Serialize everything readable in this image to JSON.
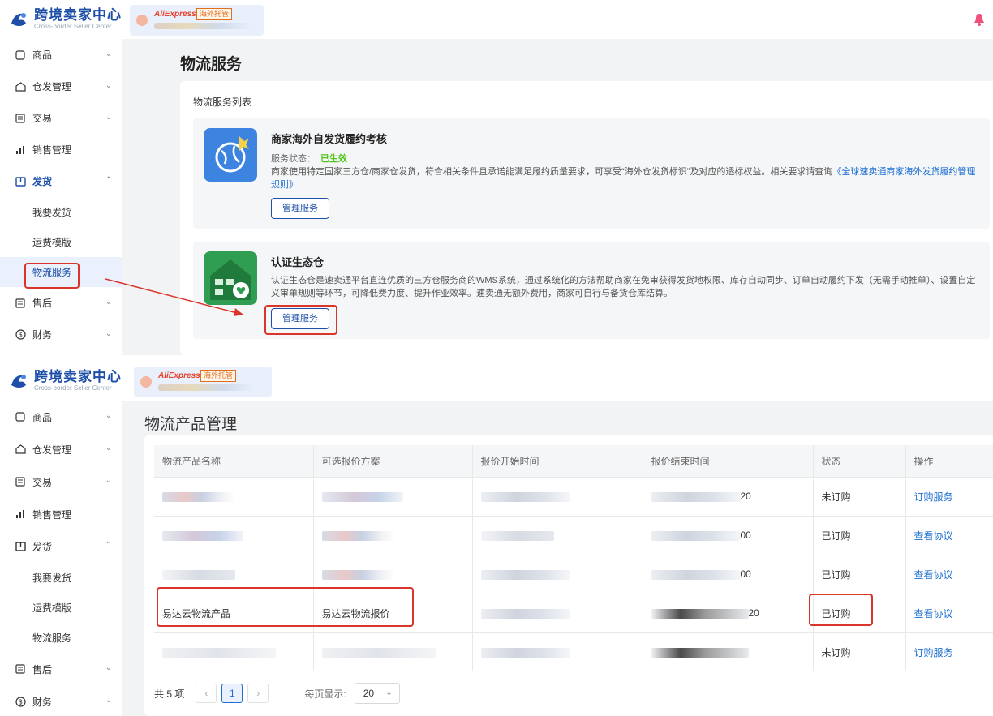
{
  "app": {
    "title": "跨境卖家中心",
    "subtitle": "Cross-border Seller Center"
  },
  "store": {
    "platform": "AliExpress",
    "tag": "海外托管"
  },
  "sidebar": {
    "items": [
      {
        "label": "商品",
        "icon": "box-icon"
      },
      {
        "label": "仓发管理",
        "icon": "warehouse-icon"
      },
      {
        "label": "交易",
        "icon": "list-icon"
      },
      {
        "label": "销售管理",
        "icon": "chart-icon"
      },
      {
        "label": "发货",
        "icon": "truck-icon"
      }
    ],
    "sub_items": [
      "我要发货",
      "运费模版",
      "物流服务"
    ],
    "after_items": [
      {
        "label": "售后",
        "icon": "list-icon"
      },
      {
        "label": "财务",
        "icon": "money-icon"
      }
    ]
  },
  "top_page": {
    "title": "物流服务",
    "card_label": "物流服务列表",
    "services": [
      {
        "name": "商家海外自发货履约考核",
        "status_label": "服务状态：",
        "status_value": "已生效",
        "desc": "商家使用特定国家三方仓/商家仓发货，符合相关条件且承诺能满足履约质量要求，可享受“海外仓发货标识”及对应的透标权益。相关要求请查询",
        "link": "《全球速卖通商家海外发货履约管理规则》",
        "button": "管理服务"
      },
      {
        "name": "认证生态仓",
        "desc": "认证生态仓是速卖通平台直连优质的三方仓服务商的WMS系统，通过系统化的方法帮助商家在免审获得发货地权限、库存自动同步、订单自动履约下发（无需手动推单）、设置自定义审单规则等环节，可降低费力度、提升作业效率。速卖通无额外费用，商家可自行与备货仓库结算。",
        "button": "管理服务"
      }
    ]
  },
  "bottom_page": {
    "title": "物流产品管理",
    "columns": [
      "物流产品名称",
      "可选报价方案",
      "报价开始时间",
      "报价结束时间",
      "状态",
      "操作"
    ],
    "rows": [
      {
        "name": "",
        "plan": "",
        "start": "2024-...",
        "end": "20",
        "status": "未订购",
        "action": "订购服务"
      },
      {
        "name": "",
        "plan": "",
        "start": "2024-10-25 ...",
        "end": "00",
        "status": "已订购",
        "action": "查看协议"
      },
      {
        "name": "",
        "plan": "",
        "start": "2024-10-31 ...00",
        "end": "00",
        "status": "已订购",
        "action": "查看协议"
      },
      {
        "name": "易达云物流产品",
        "plan": "易达云物流报价",
        "start": "2024...",
        "end": "20",
        "status": "已订购",
        "action": "查看协议"
      },
      {
        "name": "",
        "plan": "",
        "start": "2024-...",
        "end": "",
        "status": "未订购",
        "action": "订购服务"
      }
    ],
    "pagination": {
      "total": "共 5 项",
      "prev": "‹",
      "current": "1",
      "next": "›",
      "per_page_label": "每页显示:",
      "per_page_value": "20"
    }
  },
  "colors": {
    "brand": "#1d4fa8",
    "link": "#1d6fd1",
    "active_green": "#52c41a",
    "highlight_red": "#d9352b"
  }
}
